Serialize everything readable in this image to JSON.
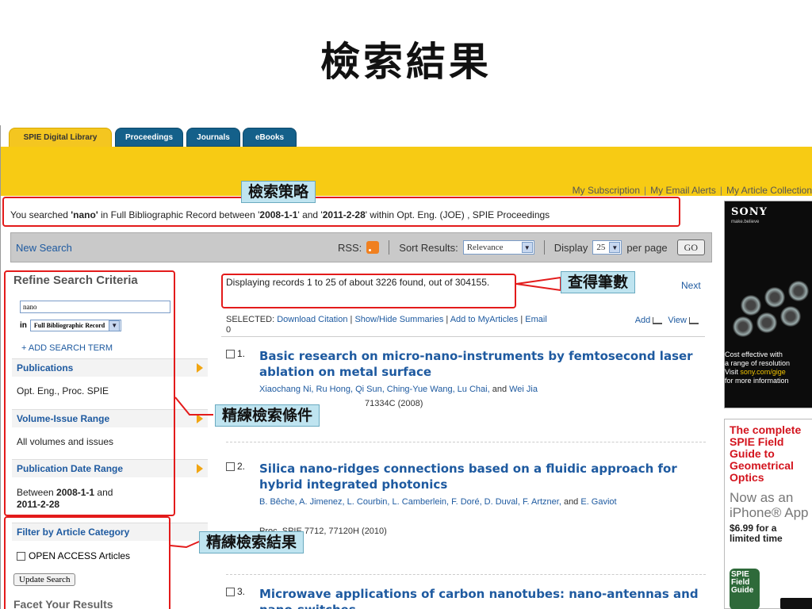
{
  "slide": {
    "title": "檢索結果"
  },
  "tabs": {
    "main": "SPIE Digital Library",
    "t1": "Proceedings",
    "t2": "Journals",
    "t3": "eBooks"
  },
  "toplinks": {
    "subscription": "My Subscription",
    "alerts": "My Email Alerts",
    "collection": "My Article Collection"
  },
  "search_summary": {
    "p1": "You searched ",
    "term": "'nano'",
    "p2": " in Full Bibliographic Record between '",
    "from": "2008-1-1",
    "p3": "' and '",
    "to": "2011-2-28",
    "p4": "' within Opt. Eng. (JOE) , SPIE Proceedings"
  },
  "toolbar": {
    "new_search": "New Search",
    "rss": "RSS:",
    "sort_label": "Sort Results:",
    "sort_value": "Relevance",
    "display_label": "Display",
    "display_value": "25",
    "per_page": "per page",
    "go": "GO"
  },
  "sidebar": {
    "title": "Refine Search Criteria",
    "query": "nano",
    "in_label": "in",
    "in_value": "Full Bibliographic Record",
    "add_term": "+ ADD SEARCH TERM",
    "publications": "Publications",
    "publications_value": "Opt. Eng., Proc. SPIE",
    "volume": "Volume-Issue Range",
    "volume_value": "All volumes and issues",
    "pubdate": "Publication Date Range",
    "pubdate_pre": "Between ",
    "pubdate_from": "2008-1-1",
    "pubdate_mid": " and",
    "pubdate_to": "2011-2-28",
    "filter": "Filter by Article Category",
    "open_access": "OPEN ACCESS Articles",
    "update": "Update Search",
    "facet": "Facet Your Results"
  },
  "results": {
    "displaying": "Displaying records 1 to 25 of about 3226 found, out of 304155.",
    "next": "Next",
    "selected_label": "SELECTED:",
    "selected_count": "0",
    "download": "Download Citation",
    "showhide": "Show/Hide Summaries",
    "myarticles": "Add to MyArticles",
    "email": "Email",
    "add": "Add",
    "view": "View",
    "items": [
      {
        "num": "1.",
        "title": "Basic research on micro-nano-instruments by femtosecond laser ablation on metal surface",
        "authors": "Xiaochang Ni, Ru Hong, Qi Sun, Ching-Yue Wang, Lu Chai,",
        "and": " and ",
        "last": "Wei Jia",
        "cite": "71334C (2008)"
      },
      {
        "num": "2.",
        "title": "Silica nano-ridges connections based on a fluidic approach for hybrid integrated photonics",
        "authors": "B. Bêche, A. Jimenez, L. Courbin, L. Camberlein, F. Doré, D. Duval, F. Artzner,",
        "and": " and ",
        "last": "E. Gaviot",
        "cite": "Proc. SPIE 7712, 77120H (2010)"
      },
      {
        "num": "3.",
        "title": "Microwave applications of carbon nanotubes: nano-antennas and nano-switches"
      }
    ]
  },
  "ads": {
    "sony_logo": "SONY",
    "sony_tag": "make.believe",
    "sony_l1": "Cost effective with",
    "sony_l2": "a range of resolution",
    "sony_l3a": "Visit ",
    "sony_l3b": "sony.com/gige",
    "sony_l4": "for more information",
    "field_red": "The complete SPIE Field Guide to Geometrical Optics",
    "field_gray1": "Now as an",
    "field_gray2": "iPhone® App",
    "field_price": "$6.99 for a limited time",
    "guide_icon": "SPIE Field Guide"
  },
  "annotations": {
    "strategy": "檢索策略",
    "count": "查得筆數",
    "refine_criteria": "精練檢索條件",
    "refine_results": "精練檢索結果"
  },
  "colors": {
    "accent_blue": "#1e5aa0",
    "yellow": "#f7cb14",
    "annotation_red": "#e31b1b"
  }
}
